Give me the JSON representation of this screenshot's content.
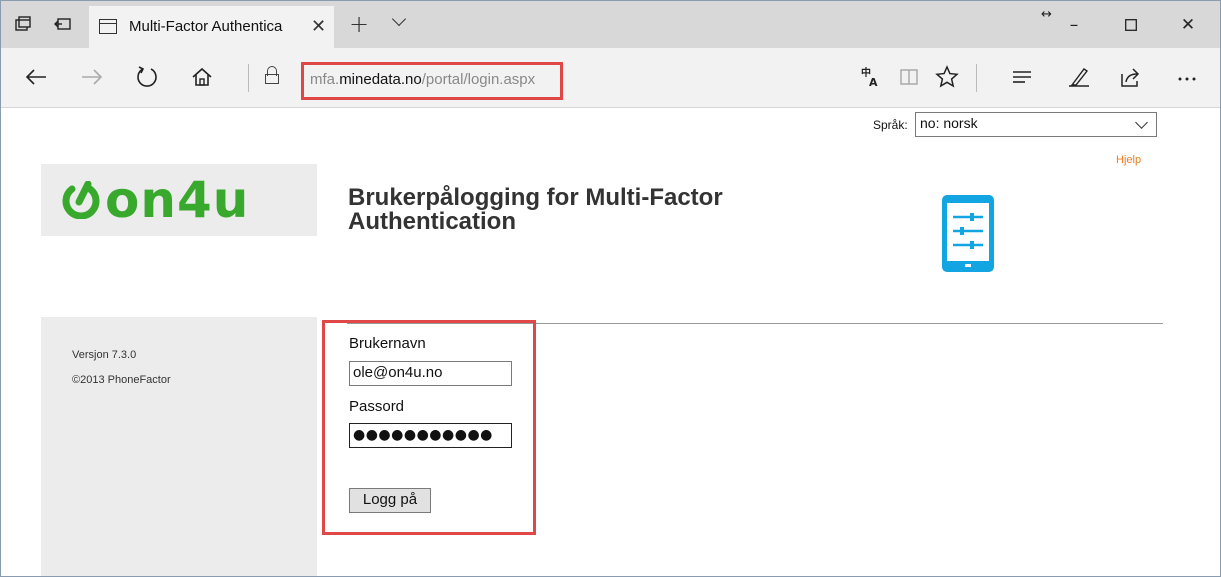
{
  "browser": {
    "tab_title": "Multi-Factor Authentica",
    "address": {
      "subdomain": "mfa.",
      "domain": "minedata.no",
      "path": "/portal/login.aspx"
    },
    "icons": {
      "tab_preview": "tab-preview-icon",
      "set_aside": "set-aside-tabs-icon",
      "back": "back-arrow-icon",
      "forward": "forward-arrow-icon",
      "refresh": "refresh-icon",
      "home": "home-icon",
      "lock": "lock-icon",
      "translate": "translate-icon",
      "reading_view": "reading-view-icon",
      "favorite": "star-icon",
      "hub": "hub-icon",
      "notes": "pen-icon",
      "share": "share-icon",
      "more": "more-icon"
    }
  },
  "language": {
    "label": "Språk:",
    "selected": "no: norsk"
  },
  "help_link": "Hjelp",
  "logo_text": "on4u",
  "heading": "Brukerpålogging for Multi-Factor Authentication",
  "sidebar": {
    "version": "Versjon 7.3.0",
    "copyright": "©2013 PhoneFactor"
  },
  "login": {
    "username_label": "Brukernavn",
    "username_value": "ole@on4u.no",
    "password_label": "Passord",
    "password_value": "●●●●●●●●●●●",
    "submit_label": "Logg på"
  },
  "colors": {
    "highlight": "#e04848",
    "logo_green": "#39a92d",
    "phone_blue": "#12a5e2",
    "help_orange": "#f07d1a"
  }
}
